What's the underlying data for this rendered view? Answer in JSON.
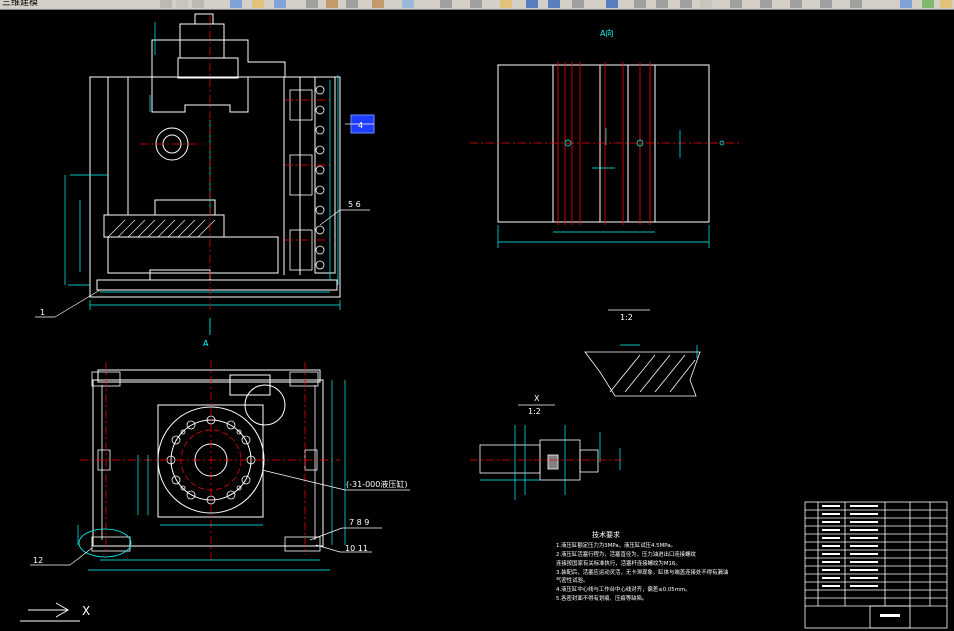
{
  "toolbar": {
    "menu_text": "三维建模"
  },
  "drawing": {
    "view_a_title": "A向",
    "view_a_arrow": "A",
    "scale_1": "1:2",
    "detail_x_label": "X",
    "detail_x_scale": "1:2",
    "tech_title": "技术要求",
    "tech_lines": [
      "1.液压缸额定压力为3MPa，液压缸试压4.5MPa。",
      "2.液压缸活塞行程为，活塞直径为，压力油进出口连接螺纹",
      "  连接按国家有关标准执行，活塞杆连接螺纹为M16。",
      "3.装配后，活塞应运动灵活，无卡滞现象，缸体与端盖连接处不得有漏油",
      "  气密性试验。",
      "4.液压缸中心线与工作台中心线对齐，偏差≤0.05mm。",
      "5.各密封面不得有划痕、压痕等缺陷。"
    ],
    "callouts": {
      "c1": "1",
      "c4": "4",
      "c56": "5  6",
      "c789": "7  8  9",
      "c1011": "10 11",
      "c12": "12",
      "c_note": "(-31-000液压缸)"
    },
    "ucs_x": "X"
  },
  "colors": {
    "background": "#000000",
    "line": "#ffffff",
    "dim": "#00ffff",
    "center": "#ff0000",
    "selection": "#1e3cff"
  }
}
